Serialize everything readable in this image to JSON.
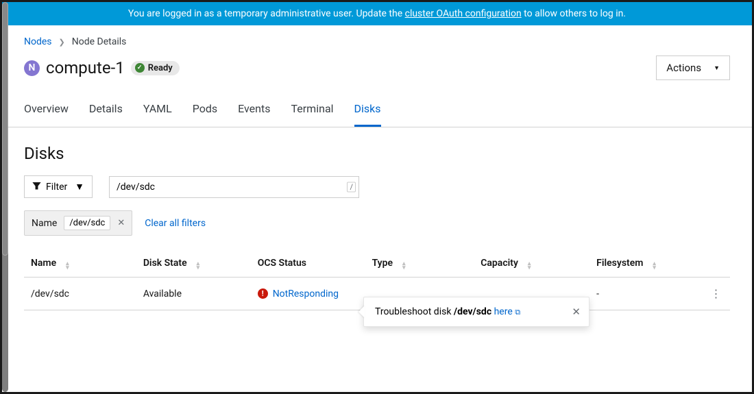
{
  "banner": {
    "prefix": "You are logged in as a temporary administrative user. Update the ",
    "link": "cluster OAuth configuration",
    "suffix": " to allow others to log in."
  },
  "breadcrumb": {
    "root": "Nodes",
    "current": "Node Details"
  },
  "node": {
    "badge": "N",
    "name": "compute-1",
    "status": "Ready"
  },
  "actions": "Actions",
  "tabs": [
    "Overview",
    "Details",
    "YAML",
    "Pods",
    "Events",
    "Terminal",
    "Disks"
  ],
  "activeTab": "Disks",
  "section": "Disks",
  "filter": {
    "label": "Filter",
    "shortcut": "/",
    "value": "/dev/sdc"
  },
  "chip": {
    "category": "Name",
    "value": "/dev/sdc"
  },
  "clear": "Clear all filters",
  "columns": {
    "name": "Name",
    "state": "Disk State",
    "ocs": "OCS Status",
    "type": "Type",
    "cap": "Capacity",
    "fs": "Filesystem"
  },
  "row": {
    "name": "/dev/sdc",
    "state": "Available",
    "ocs": "NotResponding",
    "type": "",
    "cap": "",
    "fs": "-"
  },
  "popover": {
    "prefix": "Troubleshoot disk ",
    "disk": "/dev/sdc",
    "sep": " ",
    "link": "here"
  }
}
